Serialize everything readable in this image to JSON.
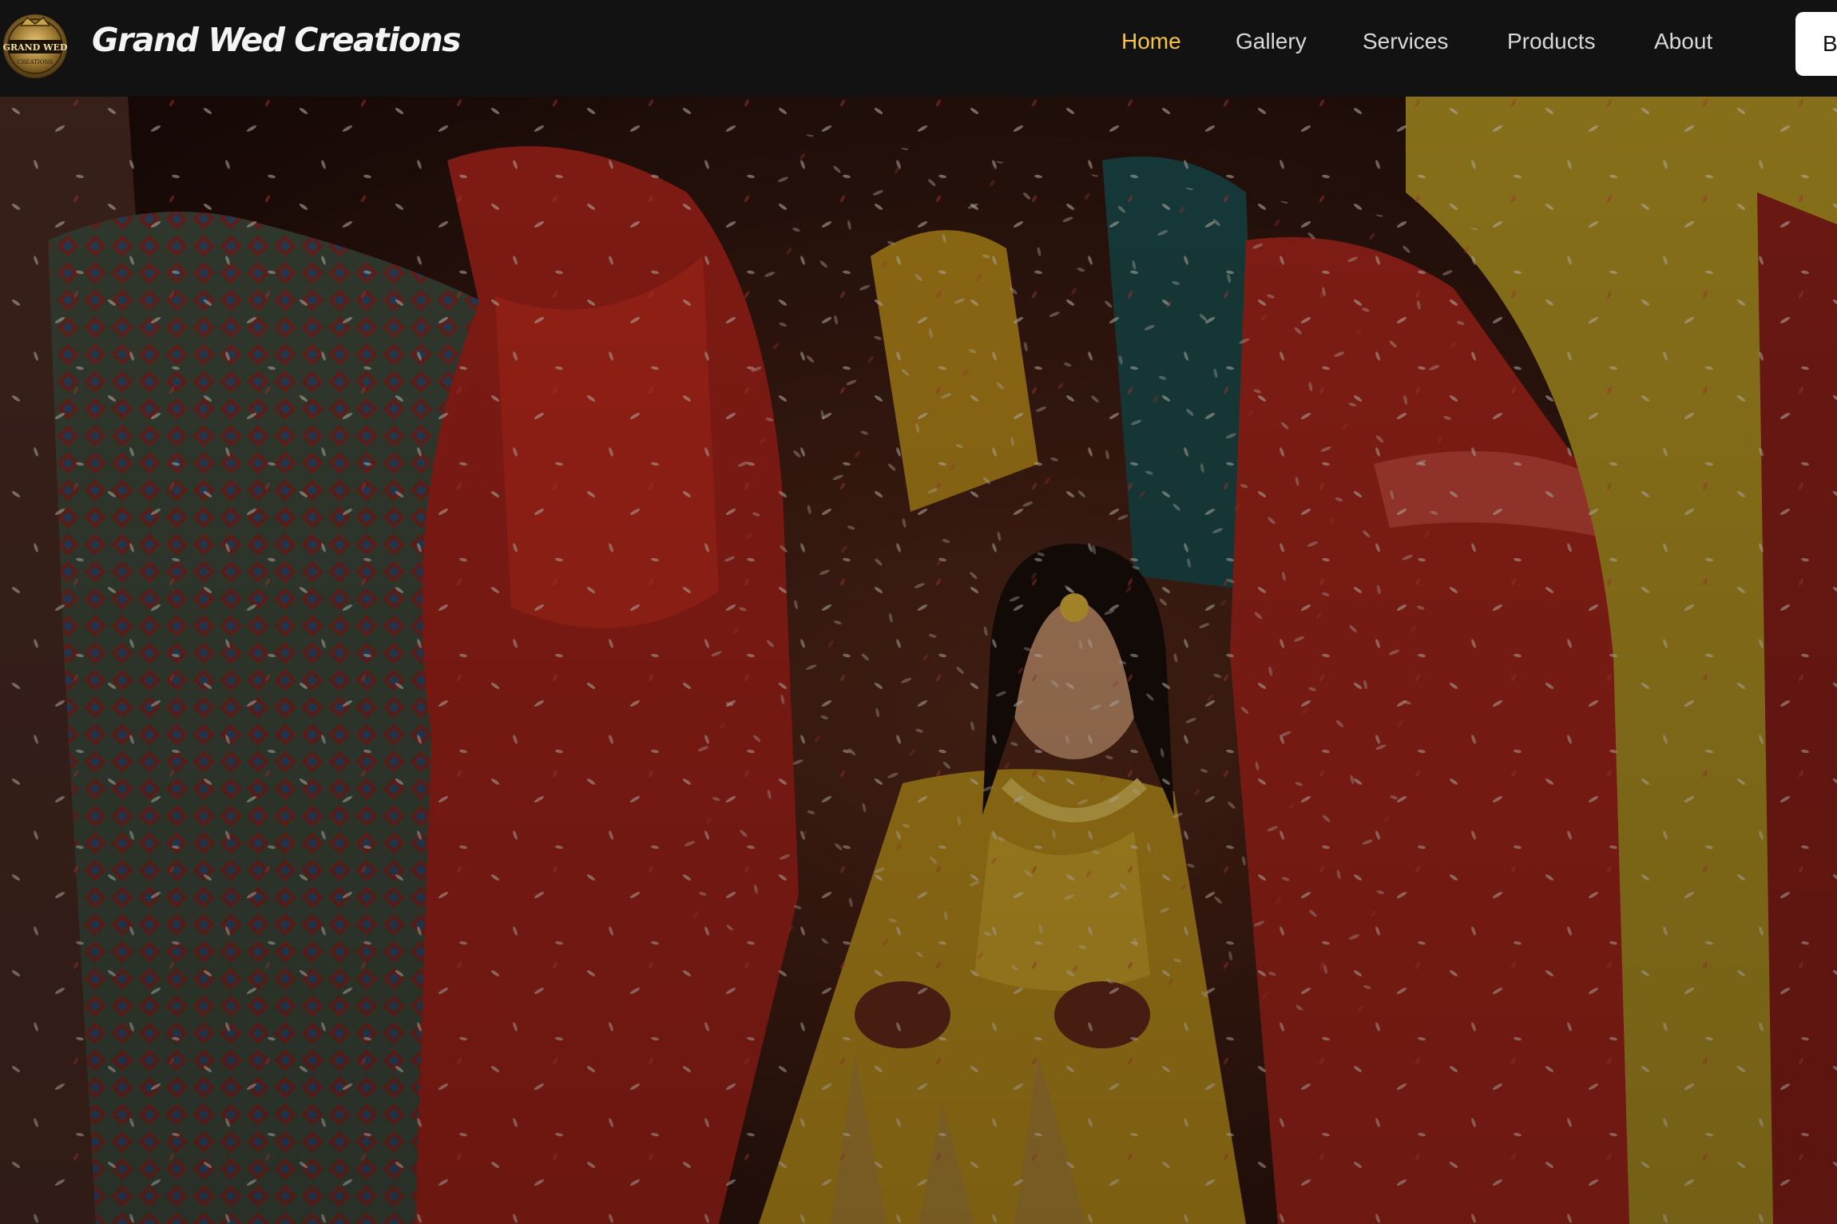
{
  "brand": {
    "name": "Grand Wed Creations",
    "logo_text_top": "GRAND WED",
    "logo_text_bottom": "CREATIONS",
    "logo_icon": "crest-logo-icon"
  },
  "nav": {
    "items": [
      {
        "label": "Home",
        "active": true
      },
      {
        "label": "Gallery",
        "active": false
      },
      {
        "label": "Services",
        "active": false
      },
      {
        "label": "Products",
        "active": false
      },
      {
        "label": "About",
        "active": false
      }
    ],
    "cta_label": "B"
  },
  "hero": {
    "description_icon": "wedding-photo-image"
  },
  "colors": {
    "nav_bg": "#121212",
    "active_link": "#f6c445",
    "link": "#d8d8d8",
    "cta_bg": "#ffffff"
  }
}
